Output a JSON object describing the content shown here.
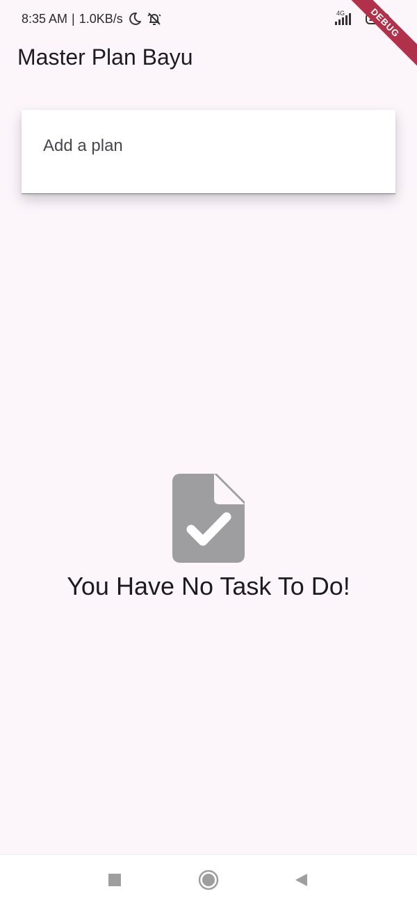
{
  "status_bar": {
    "time": "8:35 AM",
    "separator": "|",
    "net_speed": "1.0KB/s",
    "icons": [
      "moon-icon",
      "alarm-off-icon"
    ],
    "network_type": "4G",
    "battery_level": "20"
  },
  "debug_banner": "DEBUG",
  "app_bar": {
    "title": "Master Plan Bayu"
  },
  "plan_input": {
    "placeholder": "Add a plan",
    "value": ""
  },
  "empty_state": {
    "icon": "task-file-check-icon",
    "message": "You Have No Task To Do!"
  },
  "nav_bar": {
    "buttons": [
      "recents-square-icon",
      "home-circle-icon",
      "back-triangle-icon"
    ]
  },
  "colors": {
    "background": "#fcf6fb",
    "icon_gray": "#9e9d9f",
    "text": "#1d1b20",
    "debug_ribbon": "#b0324a"
  }
}
